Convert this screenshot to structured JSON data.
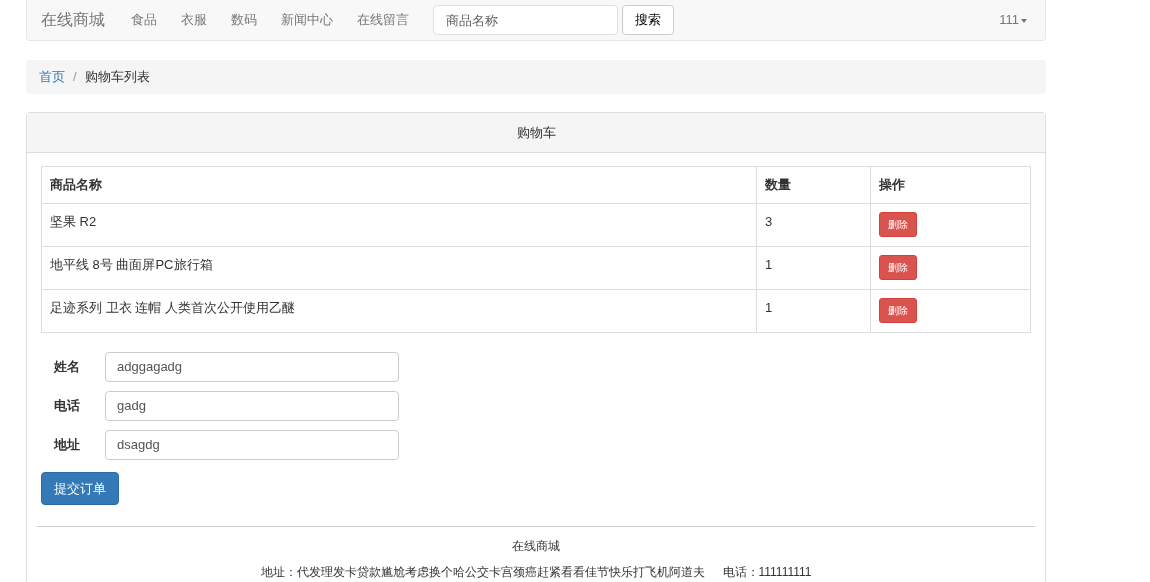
{
  "navbar": {
    "brand": "在线商城",
    "links": [
      "食品",
      "衣服",
      "数码",
      "新闻中心",
      "在线留言"
    ],
    "search": {
      "placeholder": "商品名称",
      "button": "搜索"
    },
    "user": "111"
  },
  "breadcrumb": {
    "separator": "/",
    "items": [
      {
        "label": "首页",
        "link": true
      },
      {
        "label": "购物车列表",
        "link": false
      }
    ]
  },
  "cart": {
    "title": "购物车",
    "table": {
      "columns": [
        "商品名称",
        "数量",
        "操作"
      ],
      "rows": [
        {
          "name": "坚果 R2",
          "quantity": "3",
          "action": "删除"
        },
        {
          "name": "地平线 8号 曲面屏PC旅行箱",
          "quantity": "1",
          "action": "删除"
        },
        {
          "name": "足迹系列 卫衣 连帽 人类首次公开使用乙醚",
          "quantity": "1",
          "action": "删除"
        }
      ]
    },
    "form": [
      {
        "label": "姓名",
        "value": "adggagadg"
      },
      {
        "label": "电话",
        "value": "gadg"
      },
      {
        "label": "地址",
        "value": "dsagdg"
      }
    ],
    "submit": "提交订单"
  },
  "footer": {
    "title": "在线商城",
    "address": "地址：代发理发卡贷款尴尬考虑换个哈公交卡宫颈癌赶紧看看佳节快乐打飞机阿道夫",
    "phone": "电话：111111111"
  }
}
